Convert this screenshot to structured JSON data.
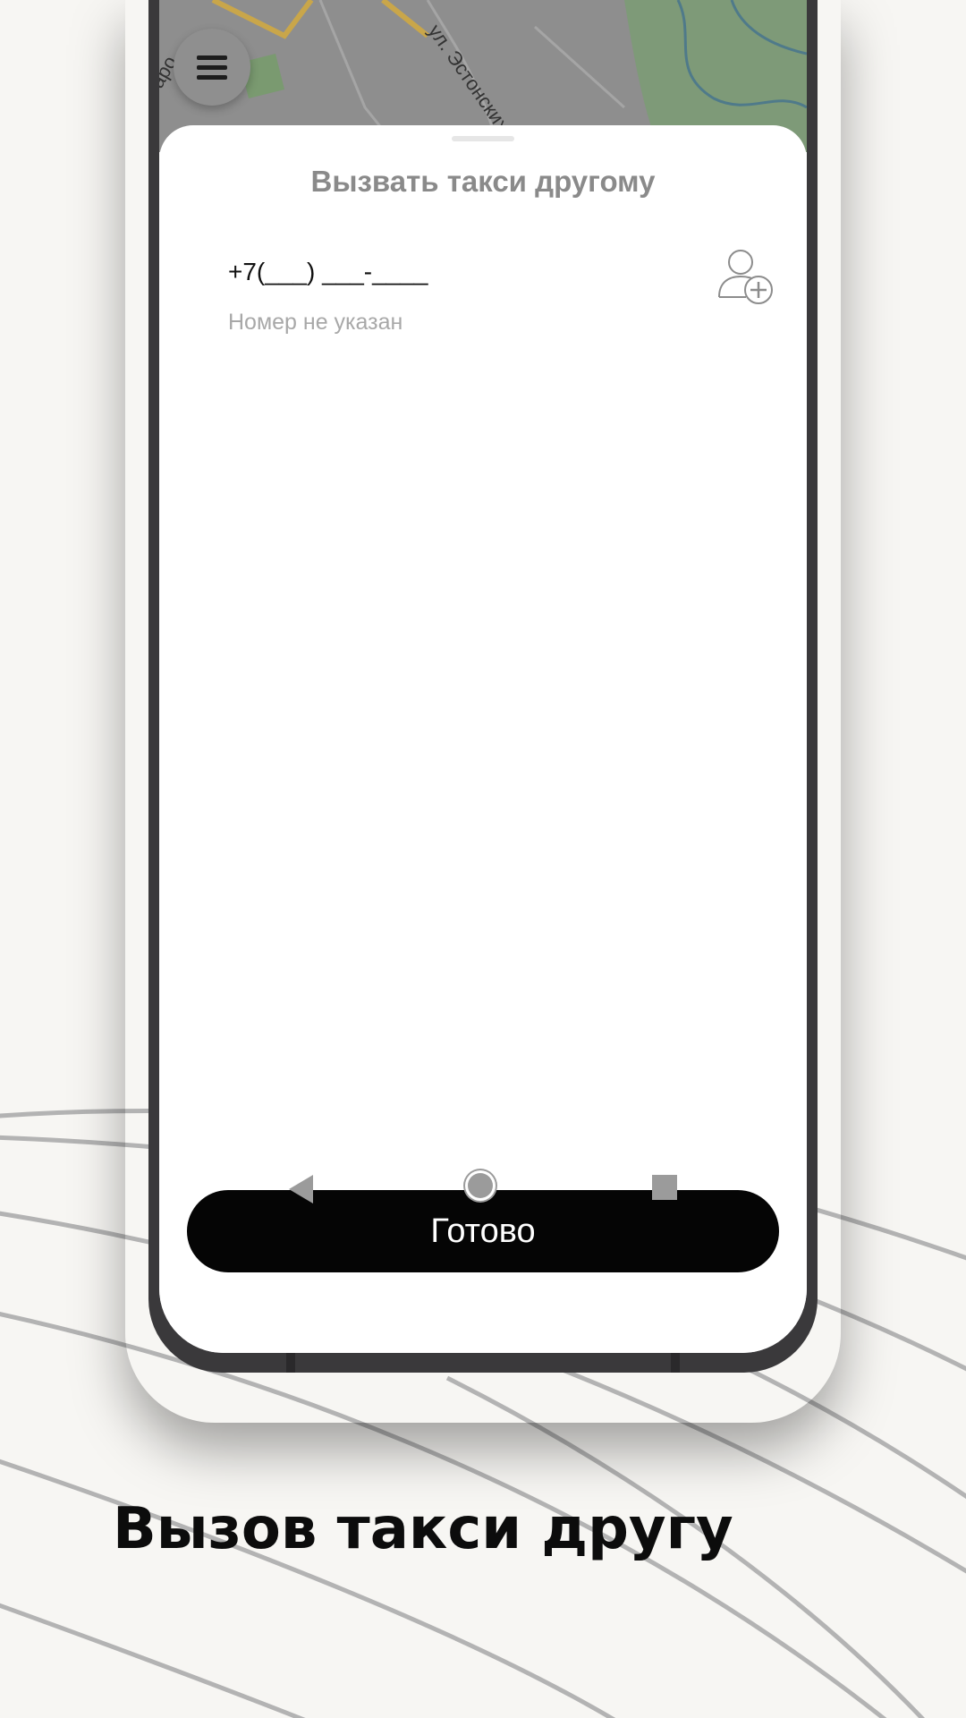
{
  "map": {
    "street_label": "ул. Эстонских",
    "street_label_left": "аро"
  },
  "menu": {
    "icon": "hamburger-icon"
  },
  "sheet": {
    "title": "Вызвать такси другому",
    "phone_value": "+7(___) ___-____",
    "phone_hint": "Номер не указан",
    "add_contact_icon": "add-person-icon",
    "done_label": "Готово"
  },
  "nav": {
    "back_icon": "back-triangle-icon",
    "home_icon": "home-circle-icon",
    "recent_icon": "recent-square-icon"
  },
  "caption": {
    "text": "Вызов такси другу"
  },
  "colors": {
    "background": "#f7f6f3",
    "button": "#050505",
    "title": "#8a8a8a",
    "hint": "#a8a8a8",
    "phone_frame": "#3a393b"
  }
}
